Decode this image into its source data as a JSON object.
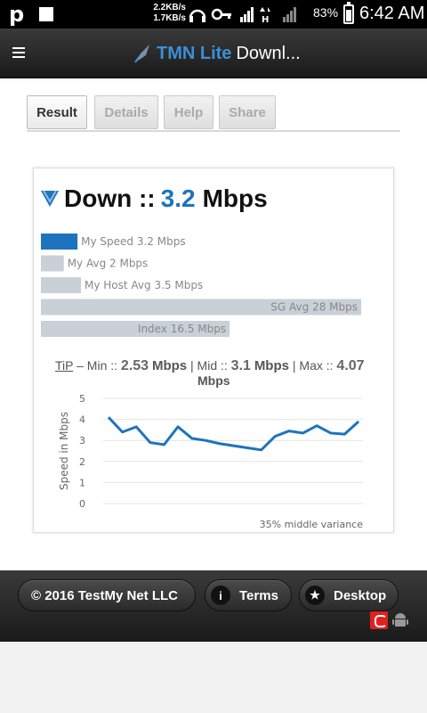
{
  "status_bar": {
    "app_letter": "p",
    "net_up": "2.2KB/s",
    "net_down": "1.7KB/s",
    "battery": "83%",
    "battery_level": 0.83,
    "time": "6:42 AM"
  },
  "app_bar": {
    "title_brand": "TMN Lite",
    "title_rest": "Downl..."
  },
  "tabs": [
    {
      "label": "Result",
      "active": true
    },
    {
      "label": "Details",
      "active": false
    },
    {
      "label": "Help",
      "active": false
    },
    {
      "label": "Share",
      "active": false
    }
  ],
  "result": {
    "direction": "Down ::",
    "value": "3.2",
    "unit": "Mbps",
    "accent_color": "#1e73be",
    "bars": [
      {
        "label": "My Speed 3.2 Mbps",
        "value": 3.2,
        "color": "#1e73be"
      },
      {
        "label": "My Avg 2 Mbps",
        "value": 2,
        "color": "#c9d0d8"
      },
      {
        "label": "My Host Avg 3.5 Mbps",
        "value": 3.5,
        "color": "#c9d0d8"
      },
      {
        "label": "SG Avg 28 Mbps",
        "value": 28,
        "color": "#c9d0d8"
      },
      {
        "label": "Index 16.5 Mbps",
        "value": 16.5,
        "color": "#c9d0d8"
      }
    ],
    "bar_scale_max": 28
  },
  "tip": {
    "label": "TiP",
    "min_label": "– Min ::",
    "min_value": "2.53",
    "mid_label": "| Mid ::",
    "mid_value": "3.1",
    "max_label": "| Max ::",
    "max_value": "4.07",
    "unit": "Mbps"
  },
  "chart_data": {
    "type": "line",
    "ylabel": "Speed in Mbps",
    "xlabel": "",
    "ylim": [
      0,
      5
    ],
    "yticks": [
      "5",
      "4",
      "3",
      "2",
      "1",
      "0"
    ],
    "values": [
      4.1,
      3.4,
      3.65,
      2.9,
      2.8,
      3.65,
      3.1,
      3.0,
      2.85,
      2.75,
      2.65,
      2.55,
      3.2,
      3.45,
      3.35,
      3.7,
      3.35,
      3.3,
      3.9
    ],
    "annotation": "35% middle variance",
    "line_color": "#1e73be"
  },
  "footer": {
    "copyright": "© 2016 TestMy Net LLC",
    "terms": "Terms",
    "desktop": "Desktop"
  }
}
